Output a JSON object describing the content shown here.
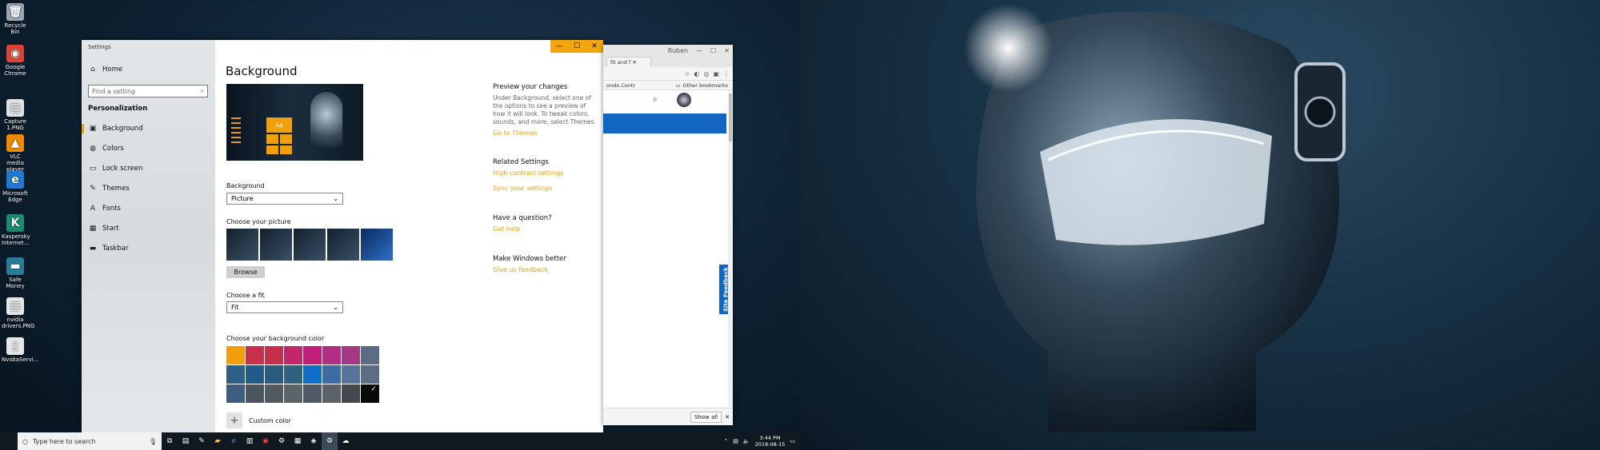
{
  "desktop_icons": [
    {
      "label": "Recycle Bin",
      "glyph": "🗑",
      "color": "#9aa6b2"
    },
    {
      "label": "Google Chrome",
      "glyph": "◉",
      "color": "#db4437"
    },
    {
      "label": "Capture 1.PNG",
      "glyph": "▦",
      "color": "#dfe3e8"
    },
    {
      "label": "VLC media player",
      "glyph": "▲",
      "color": "#f08a00"
    },
    {
      "label": "Microsoft Edge",
      "glyph": "e",
      "color": "#1f78d1"
    },
    {
      "label": "Kaspersky Internet...",
      "glyph": "K",
      "color": "#1a8b6e"
    },
    {
      "label": "Safe Money",
      "glyph": "▬",
      "color": "#2a7d9a"
    },
    {
      "label": "nvidia drivers.PNG",
      "glyph": "▦",
      "color": "#e6e6e6"
    },
    {
      "label": "NvidiaServi...",
      "glyph": "▯",
      "color": "#e6e6e6"
    }
  ],
  "settings": {
    "app_title": "Settings",
    "nav": {
      "home": "Home",
      "search_placeholder": "Find a setting",
      "section": "Personalization",
      "items": [
        "Background",
        "Colors",
        "Lock screen",
        "Themes",
        "Fonts",
        "Start",
        "Taskbar"
      ]
    },
    "page_title": "Background",
    "preview_tile": "Aa",
    "background_label": "Background",
    "background_value": "Picture",
    "choose_picture_label": "Choose your picture",
    "browse_label": "Browse",
    "fit_label": "Choose a fit",
    "fit_value": "Fit",
    "bgcolor_label": "Choose your background color",
    "custom_color_label": "Custom color",
    "swatches": [
      "#f29f0e",
      "#c8304a",
      "#c43049",
      "#c2276a",
      "#c21d79",
      "#b12e84",
      "#a43786",
      "#5b6b84",
      "#2e5f86",
      "#235a8a",
      "#2b5a7f",
      "#2d6281",
      "#0f6fc8",
      "#3f6ba3",
      "#57739c",
      "#5b6c85",
      "#3d5e82",
      "#4a5560",
      "#525a60",
      "#5b6469",
      "#4f5963",
      "#5a6168",
      "#44494d",
      "#0a0a0a"
    ],
    "right": {
      "preview_head": "Preview your changes",
      "preview_text": "Under Background, select one of the options to see a preview of how it will look. To tweak colors, sounds, and more, select Themes.",
      "go_themes": "Go to Themes",
      "related_head": "Related Settings",
      "high_contrast": "High contrast settings",
      "sync": "Sync your settings",
      "question_head": "Have a question?",
      "get_help": "Get help",
      "better_head": "Make Windows better",
      "feedback": "Give us feedback"
    }
  },
  "chrome": {
    "profile": "Ruben",
    "tab_label": "fit and f",
    "bookmark_left": "ondo Contr",
    "other_bookmarks": "Other bookmarks",
    "site_feedback": "Site Feedback",
    "show_all": "Show all"
  },
  "taskbar": {
    "search_placeholder": "Type here to search",
    "time": "3:44 PM",
    "date": "2018-08-15",
    "date_right": "2018-08-1"
  }
}
